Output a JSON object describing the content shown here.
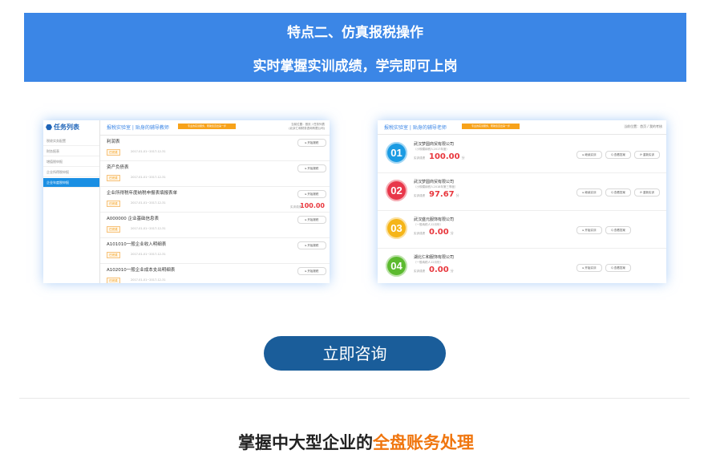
{
  "banner": {
    "line1": "特点二、仿真报税操作",
    "line2": "实时掌握实训成绩，学完即可上岗"
  },
  "left_screenshot": {
    "sidebar_title": "任务列表",
    "sidebar_items": [
      "税收实务配置",
      "财务报表",
      "增值税申报",
      "企业所得税申报",
      "企业年度税申报"
    ],
    "active_index": 4,
    "header_title": "报税实验室 | 贴身的辅导教师",
    "header_badge": "专业的实训服务，帮助您迈出第一步",
    "header_right_1": "当前位置：首页 / 任务列表",
    "header_right_2": "(北京仁和财务咨询有限公司)",
    "rows": [
      {
        "name": "利润表",
        "tag": "已完成",
        "date": "2017-01-01~2017-12-31",
        "button": "▸ 开始报税",
        "score_label": "",
        "score": ""
      },
      {
        "name": "资产负债表",
        "tag": "已完成",
        "date": "2017-01-01~2017-12-31",
        "button": "▸ 开始报税",
        "score_label": "",
        "score": ""
      },
      {
        "name": "企业所得税年度纳税申报表填报表单",
        "tag": "已完成",
        "date": "2017-01-01~2017-12-31",
        "button": "▸ 开始报税",
        "score_label": "实训成绩",
        "score": "100.00"
      },
      {
        "name": "A000000 企业基础信息表",
        "tag": "已完成",
        "date": "2017-01-01~2017-12-31",
        "button": "▸ 开始报税",
        "score_label": "",
        "score": ""
      },
      {
        "name": "A101010一般企业收入明细表",
        "tag": "已完成",
        "date": "2017-01-01~2017-12-31",
        "button": "▸ 开始报税",
        "score_label": "",
        "score": ""
      },
      {
        "name": "A102010一般企业成本支出明细表",
        "tag": "已完成",
        "date": "2017-01-01~2017-12-31",
        "button": "▸ 开始报税",
        "score_label": "",
        "score": ""
      }
    ]
  },
  "right_screenshot": {
    "header_title": "报税实验室 | 贴身的辅导老师",
    "header_badge": "专业的实训服务，帮助您迈出第一步",
    "header_right": "当前位置：首页 / 我的考核",
    "score_label": "实训成绩",
    "score_unit": "分",
    "items": [
      {
        "num": "01",
        "color": "#1a9be3",
        "name": "武汉梦圆商贸有限公司",
        "sub": "（小规模纳税人2017年度）",
        "score": "100.00",
        "buttons": [
          "▸ 继续实训",
          "Q 查看答案",
          "⟳ 重新实训"
        ]
      },
      {
        "num": "02",
        "color": "#e8374a",
        "name": "武汉梦圆商贸有限公司",
        "sub": "（小规模纳税人2018年第三季度）",
        "score": "97.67",
        "buttons": [
          "▸ 继续实训",
          "Q 查看答案",
          "⟳ 重新实训"
        ]
      },
      {
        "num": "03",
        "color": "#f5b518",
        "name": "武汉盛元服饰有限公司",
        "sub": "（一般纳税人12月份）",
        "score": "0.00",
        "buttons": [
          "▸ 开始实训",
          "Q 查看答案"
        ]
      },
      {
        "num": "04",
        "color": "#5cba2f",
        "name": "湖北仁和服饰有限公司",
        "sub": "（一般纳税人12月份）",
        "score": "0.00",
        "buttons": [
          "▸ 开始实训",
          "Q 查看答案"
        ]
      }
    ]
  },
  "consult_button": "立即咨询",
  "bottom": {
    "title_part1": "掌握中大型企业的",
    "title_highlight": "全盘账务处理"
  }
}
